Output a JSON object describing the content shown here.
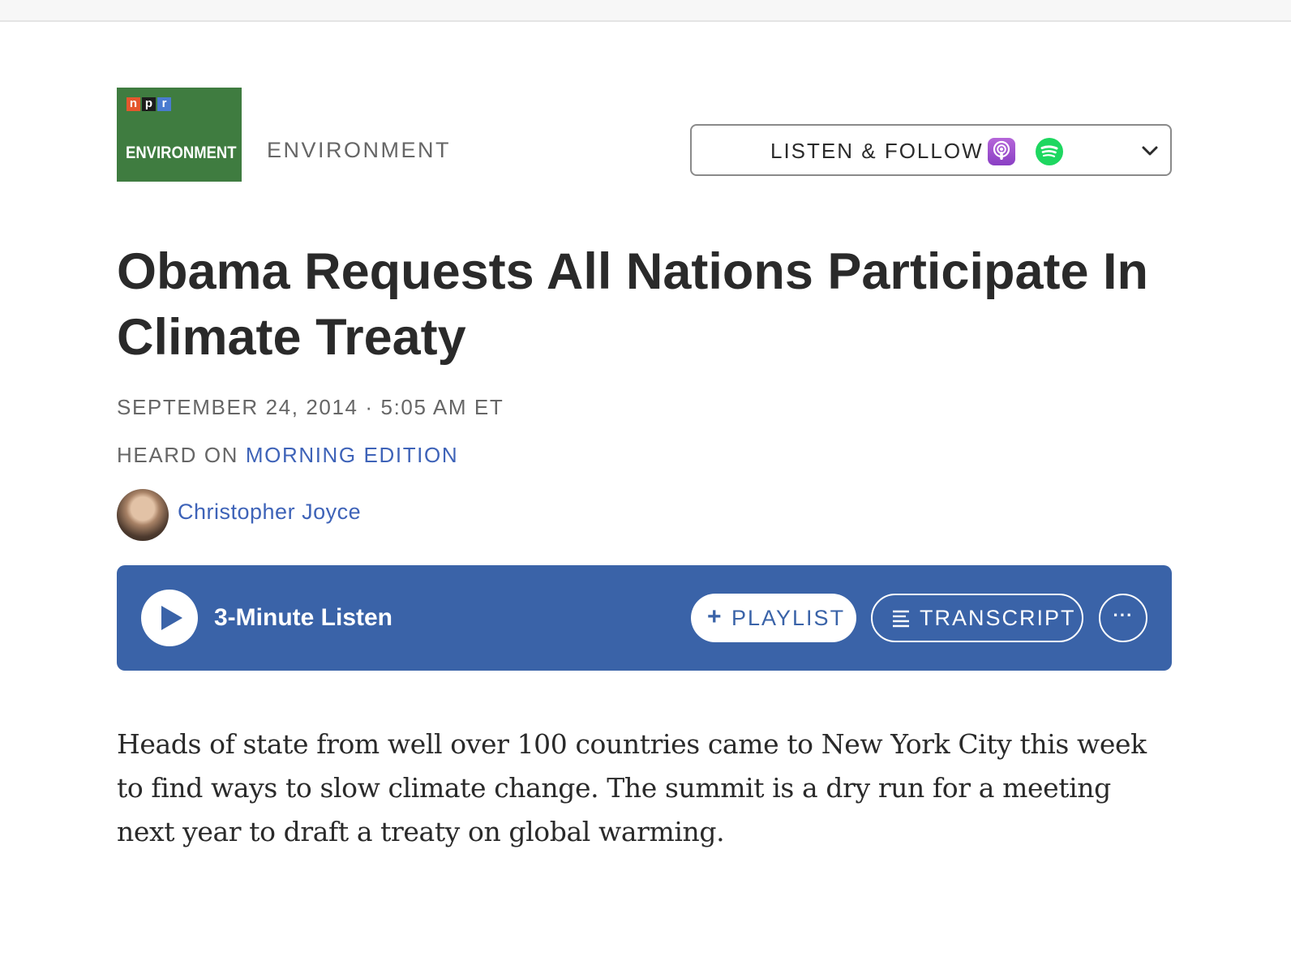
{
  "section": {
    "logo_npr_letters": [
      "n",
      "p",
      "r"
    ],
    "logo_label": "ENVIRONMENT",
    "label": "ENVIRONMENT"
  },
  "listen_follow": {
    "label": "LISTEN & FOLLOW",
    "icons": [
      "apple-podcasts-icon",
      "spotify-icon",
      "chevron-down-icon"
    ]
  },
  "article": {
    "headline": "Obama Requests All Nations Participate In Climate Treaty",
    "dateline": "SEPTEMBER 24, 2014 · 5:05 AM ET",
    "heard_on_prefix": "HEARD ON",
    "heard_on_show": "MORNING EDITION",
    "author": "Christopher Joyce",
    "body": "Heads of state from well over 100 countries came to New York City this week to find ways to slow climate change. The summit is a dry run for a meeting next year to draft a treaty on global warming."
  },
  "player": {
    "label": "3-Minute Listen",
    "playlist_plus": "+",
    "playlist_label": "PLAYLIST",
    "transcript_label": "TRANSCRIPT",
    "more_label": "···"
  },
  "colors": {
    "section_green": "#3f7c40",
    "player_blue": "#3a63a8",
    "link_blue": "#3e63b8",
    "spotify_green": "#1ed760",
    "podcasts_purple": "#9a4fd0"
  }
}
